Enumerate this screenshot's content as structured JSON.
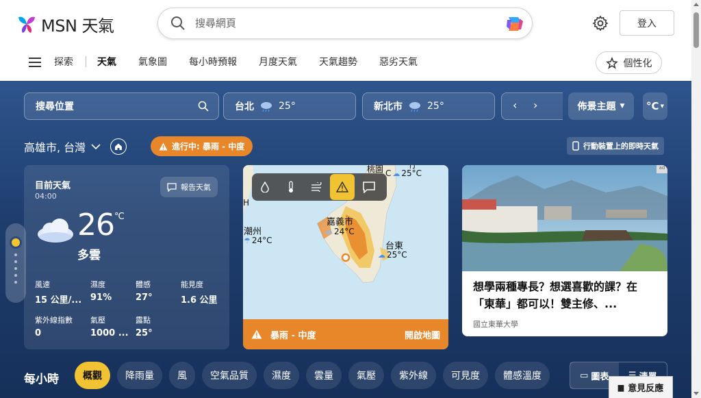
{
  "header": {
    "logo_text": "MSN 天氣",
    "search_placeholder": "搜尋網頁",
    "login_label": "登入",
    "personalize_label": "個性化"
  },
  "nav": {
    "items": [
      "探索",
      "天氣",
      "氣象圖",
      "每小時預報",
      "月度天氣",
      "天氣趨勢",
      "惡劣天氣"
    ],
    "active": "天氣"
  },
  "locationbar": {
    "search_placeholder": "搜尋位置",
    "cities": [
      {
        "name": "台北",
        "temp": "25°",
        "icon": "rain-cloud-icon"
      },
      {
        "name": "新北市",
        "temp": "25°",
        "icon": "rain-cloud-icon"
      }
    ],
    "theme_label": "佈景主題",
    "unit_label": "°C"
  },
  "location": {
    "name": "高雄市, 台灣",
    "alert_label": "進行中: 暴雨 - 中度",
    "mobile_label": "行動裝置上的即時天氣"
  },
  "current": {
    "heading": "目前天氣",
    "time": "04:00",
    "report_label": "報告天氣",
    "temp": "26",
    "unit": "°C",
    "condition": "多雲",
    "metrics": [
      {
        "label": "風速",
        "value": "15 公里/..."
      },
      {
        "label": "濕度",
        "value": "91%"
      },
      {
        "label": "體感",
        "value": "27°"
      },
      {
        "label": "能見度",
        "value": "1.6 公里"
      },
      {
        "label": "紫外線指數",
        "value": "0"
      },
      {
        "label": "氣壓",
        "value": "1000 ..."
      },
      {
        "label": "露點",
        "value": "25°"
      }
    ]
  },
  "map": {
    "labels": {
      "taoyuan": "桃園",
      "hsinchu_partial": "竹",
      "chiayi": "嘉義市",
      "chaozhou": "潮州",
      "taitung": "台東",
      "partial_c": "C",
      "h_partial": "H"
    },
    "temps": {
      "north": "25°C",
      "chiayi": "24°C",
      "chaozhou": "24°C",
      "taitung": "25°C"
    },
    "footer_alert": "暴雨 - 中度",
    "open_label": "開啟地圖"
  },
  "news": {
    "title": "想學兩種專長？想選喜歡的課？在「東華」都可以！雙主修、...",
    "source": "國立東華大學",
    "ad_badge": "ad"
  },
  "hourly": {
    "heading": "每小時",
    "chips": [
      "概觀",
      "降雨量",
      "風",
      "空氣品質",
      "濕度",
      "雲量",
      "氣壓",
      "紫外線",
      "可見度",
      "體感溫度"
    ],
    "active": "概觀",
    "view_chart": "圖表",
    "view_list": "清單"
  },
  "feedback_label": "意見反應",
  "colors": {
    "accent": "#f1c232",
    "alert": "#e8862a",
    "bg_top": "#2e558d",
    "bg_bottom": "#16305a"
  }
}
